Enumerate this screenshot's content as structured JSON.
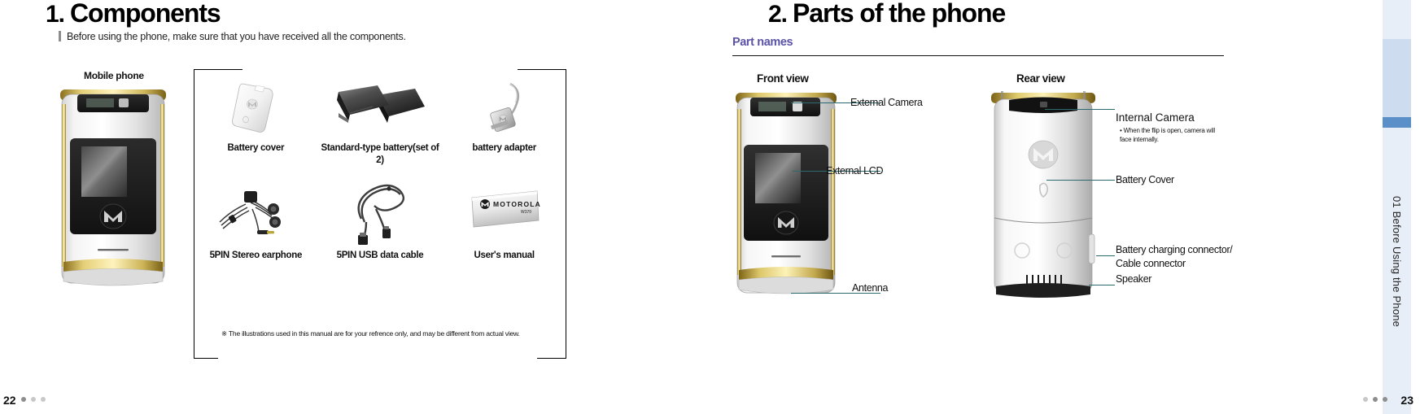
{
  "document": {
    "type": "phone-user-manual-spread",
    "accent_purple": "#5b53a6",
    "leader_line_color": "#2b6b70",
    "sidebar_accent": "#5a8fc7"
  },
  "left_page": {
    "number": "22",
    "chapter_number": "1.",
    "title": "Components",
    "subtitle": "Before using the phone, make sure that you have received all the components.",
    "mobile_phone_caption": "Mobile phone",
    "components": [
      {
        "name": "battery-cover",
        "caption": "Battery cover"
      },
      {
        "name": "standard-battery",
        "caption": "Standard-type\nbattery(set of 2)"
      },
      {
        "name": "battery-adapter",
        "caption": "battery adapter"
      },
      {
        "name": "stereo-earphone",
        "caption": "5PIN Stereo\nearphone"
      },
      {
        "name": "usb-data-cable",
        "caption": "5PIN USB\ndata cable"
      },
      {
        "name": "users-manual",
        "caption": "User's manual"
      }
    ],
    "footnote": "※ The illustrations used in this manual are for your refrence only, and may be different from actual view.",
    "manual_cover_brand": "MOTOROLA",
    "manual_cover_model": "W370"
  },
  "right_page": {
    "number": "23",
    "chapter_number": "2.",
    "title": "Parts of the phone",
    "section_label": "Part names",
    "front_view_label": "Front view",
    "rear_view_label": "Rear view",
    "front_callouts": [
      {
        "name": "external-camera",
        "label": "External Camera"
      },
      {
        "name": "external-lcd",
        "label": "External LCD"
      },
      {
        "name": "antenna",
        "label": "Antenna"
      }
    ],
    "rear_callouts": [
      {
        "name": "internal-camera",
        "label": "Internal Camera",
        "note": "• When the flip is open, camera will\n   face internally."
      },
      {
        "name": "battery-cover",
        "label": "Battery Cover"
      },
      {
        "name": "charging-connector",
        "label": "Battery charging connector/\nCable connector"
      },
      {
        "name": "speaker",
        "label": "Speaker"
      }
    ]
  },
  "sidebar": {
    "chapter_index": "01",
    "chapter_name": "Before Using the Phone",
    "tab_text": "01  Before Using the Phone"
  }
}
